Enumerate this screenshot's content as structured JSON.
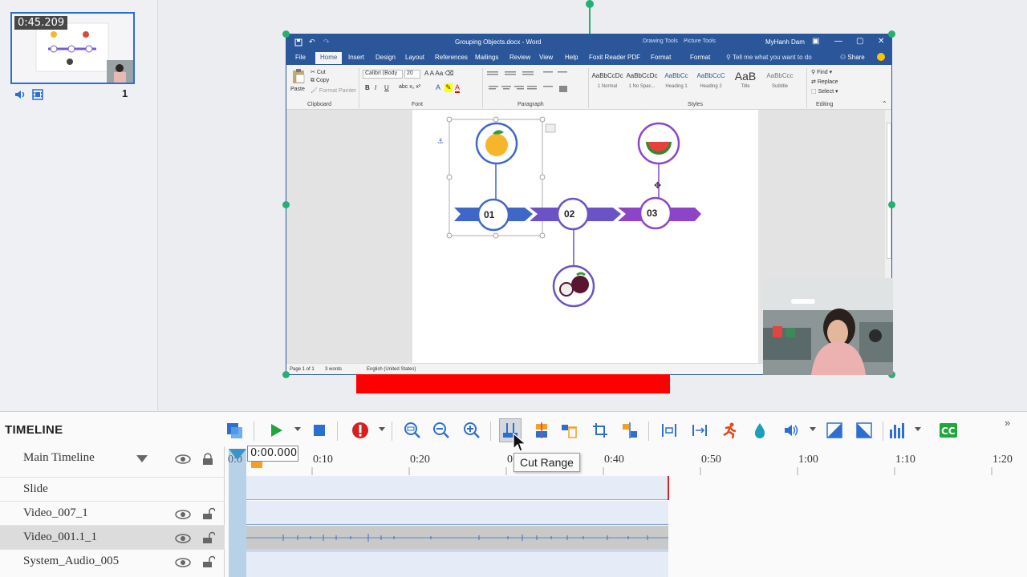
{
  "slides": {
    "thumb_time": "0:45.209",
    "slide_number": "1"
  },
  "word": {
    "title": "Grouping Objects.docx - Word",
    "context_drawing": "Drawing Tools",
    "context_picture": "Picture Tools",
    "user": "MyHanh Dam",
    "tabs": [
      "File",
      "Home",
      "Insert",
      "Design",
      "Layout",
      "References",
      "Mailings",
      "Review",
      "View",
      "Help",
      "Foxit Reader PDF",
      "Format",
      "Format"
    ],
    "tell_me": "Tell me what you want to do",
    "share": "Share",
    "clipboard": {
      "paste": "Paste",
      "cut": "Cut",
      "copy": "Copy",
      "format_painter": "Format Painter",
      "label": "Clipboard"
    },
    "font": {
      "name": "Calibri (Body",
      "size": "20",
      "label": "Font"
    },
    "paragraph_label": "Paragraph",
    "styles": [
      {
        "sample": "AaBbCcDc",
        "name": "1 Normal"
      },
      {
        "sample": "AaBbCcDc",
        "name": "1 No Spac..."
      },
      {
        "sample": "AaBbCc",
        "name": "Heading 1"
      },
      {
        "sample": "AaBbCcC",
        "name": "Heading 2"
      },
      {
        "sample": "AaB",
        "name": "Title"
      },
      {
        "sample": "AaBbCcc",
        "name": "Subtitle"
      }
    ],
    "styles_label": "Styles",
    "editing": {
      "find": "Find",
      "replace": "Replace",
      "select": "Select",
      "label": "Editing"
    },
    "diagram": {
      "step1": "01",
      "step2": "02",
      "step3": "03"
    },
    "status": {
      "page": "Page 1 of 1",
      "words": "3 words",
      "lang": "English (United States)"
    }
  },
  "timeline": {
    "title": "TIMELINE",
    "playhead_time": "0:00.000",
    "ruler_start": "0:0",
    "ticks": [
      "0:10",
      "0:20",
      "0:30",
      "0:40",
      "0:50",
      "1:00",
      "1:10",
      "1:20"
    ],
    "tracks": [
      {
        "name": "Main Timeline"
      },
      {
        "name": "Slide"
      },
      {
        "name": "Video_007_1"
      },
      {
        "name": "Video_001.1_1"
      },
      {
        "name": "System_Audio_005"
      }
    ],
    "tooltip": "Cut Range"
  },
  "colors": {
    "word_blue": "#2b579a",
    "selection_green": "#22b073",
    "red_bar": "#ff0000",
    "purple": "#8e44c7"
  }
}
